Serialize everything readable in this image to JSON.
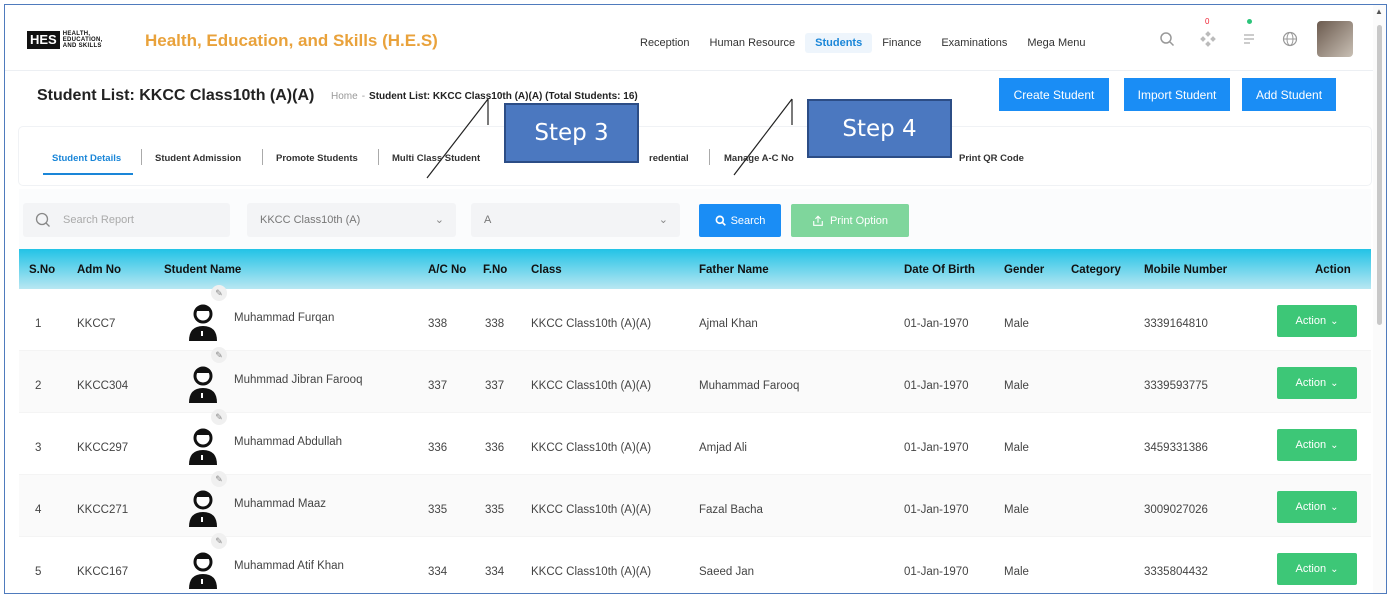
{
  "app": {
    "logo_text": "HES",
    "logo_sub": "HEALTH, EDUCATION, AND SKILLS",
    "title": "Health, Education, and Skills (H.E.S)"
  },
  "nav": [
    {
      "label": "Reception",
      "active": false
    },
    {
      "label": "Human Resource",
      "active": false
    },
    {
      "label": "Students",
      "active": true
    },
    {
      "label": "Finance",
      "active": false
    },
    {
      "label": "Examinations",
      "active": false
    },
    {
      "label": "Mega Menu",
      "active": false
    }
  ],
  "header_icons": {
    "search_icon": "search-icon",
    "apps_icon": "apps-icon",
    "apps_badge": "0",
    "messages_icon": "messages-icon",
    "language_icon": "globe-icon"
  },
  "page": {
    "title": "Student List: KKCC Class10th (A)(A)",
    "breadcrumb_home": "Home",
    "breadcrumb_current": "Student List: KKCC Class10th (A)(A) (Total Students: 16)"
  },
  "buttons": {
    "create": "Create Student",
    "import": "Import Student",
    "add": "Add Student",
    "search": "Search",
    "print": "Print Option",
    "action": "Action"
  },
  "tabs": [
    {
      "label": "Student Details"
    },
    {
      "label": "Student Admission"
    },
    {
      "label": "Promote Students"
    },
    {
      "label": "Multi Class Student"
    },
    {
      "label": "redential"
    },
    {
      "label": "Manage A-C No"
    },
    {
      "label": "Print QR Code"
    }
  ],
  "filters": {
    "search_placeholder": "Search Report",
    "class_value": "KKCC Class10th (A)",
    "section_value": "A"
  },
  "callouts": {
    "step3": "Step 3",
    "step4": "Step 4"
  },
  "table": {
    "columns": [
      "S.No",
      "Adm No",
      "Student Name",
      "A/C No",
      "F.No",
      "Class",
      "Father Name",
      "Date Of Birth",
      "Gender",
      "Category",
      "Mobile Number",
      "Action"
    ],
    "rows": [
      {
        "sno": "1",
        "adm": "KKCC7",
        "name": "Muhammad Furqan",
        "ac": "338",
        "fno": "338",
        "class": "KKCC Class10th (A)(A)",
        "father": "Ajmal Khan",
        "dob": "01-Jan-1970",
        "gender": "Male",
        "category": "",
        "mobile": "3339164810"
      },
      {
        "sno": "2",
        "adm": "KKCC304",
        "name": "Muhmmad Jibran Farooq",
        "ac": "337",
        "fno": "337",
        "class": "KKCC Class10th (A)(A)",
        "father": "Muhammad Farooq",
        "dob": "01-Jan-1970",
        "gender": "Male",
        "category": "",
        "mobile": "3339593775"
      },
      {
        "sno": "3",
        "adm": "KKCC297",
        "name": "Muhammad Abdullah",
        "ac": "336",
        "fno": "336",
        "class": "KKCC Class10th (A)(A)",
        "father": "Amjad Ali",
        "dob": "01-Jan-1970",
        "gender": "Male",
        "category": "",
        "mobile": "3459331386"
      },
      {
        "sno": "4",
        "adm": "KKCC271",
        "name": "Muhammad Maaz",
        "ac": "335",
        "fno": "335",
        "class": "KKCC Class10th (A)(A)",
        "father": "Fazal Bacha",
        "dob": "01-Jan-1970",
        "gender": "Male",
        "category": "",
        "mobile": "3009027026"
      },
      {
        "sno": "5",
        "adm": "KKCC167",
        "name": "Muhammad Atif Khan",
        "ac": "334",
        "fno": "334",
        "class": "KKCC Class10th (A)(A)",
        "father": "Saeed Jan",
        "dob": "01-Jan-1970",
        "gender": "Male",
        "category": "",
        "mobile": "3335804432"
      }
    ]
  },
  "colors": {
    "brand": "#e9a23b",
    "primary": "#1a8df5",
    "success": "#3dc777",
    "callout": "#4b78c0"
  }
}
